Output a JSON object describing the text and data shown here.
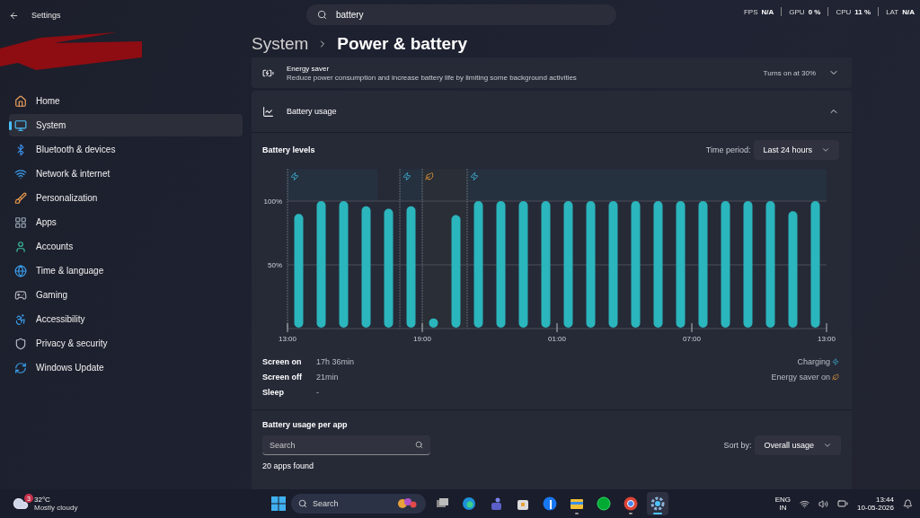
{
  "window": {
    "title": "Settings"
  },
  "search": {
    "value": "battery"
  },
  "overlay_stats": [
    {
      "label": "FPS",
      "value": "N/A"
    },
    {
      "label": "GPU",
      "value": "0 %"
    },
    {
      "label": "CPU",
      "value": "11 %"
    },
    {
      "label": "LAT",
      "value": "N/A"
    }
  ],
  "sidebar": {
    "items": [
      {
        "label": "Home",
        "selected": false
      },
      {
        "label": "System",
        "selected": true
      },
      {
        "label": "Bluetooth & devices",
        "selected": false
      },
      {
        "label": "Network & internet",
        "selected": false
      },
      {
        "label": "Personalization",
        "selected": false
      },
      {
        "label": "Apps",
        "selected": false
      },
      {
        "label": "Accounts",
        "selected": false
      },
      {
        "label": "Time & language",
        "selected": false
      },
      {
        "label": "Gaming",
        "selected": false
      },
      {
        "label": "Accessibility",
        "selected": false
      },
      {
        "label": "Privacy & security",
        "selected": false
      },
      {
        "label": "Windows Update",
        "selected": false
      }
    ]
  },
  "breadcrumb": {
    "parent": "System",
    "current": "Power & battery"
  },
  "energy_saver": {
    "title": "Energy saver",
    "description": "Reduce power consumption and increase battery life by limiting some background activities",
    "status": "Turns on at 30%",
    "expanded": false
  },
  "battery_usage": {
    "title": "Battery usage",
    "expanded": true,
    "levels_title": "Battery levels",
    "time_period_label": "Time period:",
    "time_period": "Last 24 hours",
    "chart_data": {
      "type": "bar",
      "categories": [
        "13:00",
        null,
        null,
        null,
        null,
        null,
        "19:00",
        null,
        null,
        null,
        null,
        null,
        "01:00",
        null,
        null,
        null,
        null,
        null,
        "07:00",
        null,
        null,
        null,
        null,
        null
      ],
      "series": [
        {
          "color": "#2bb5bd",
          "values": [
            90,
            100,
            100,
            96,
            94,
            96,
            8,
            89,
            100,
            100,
            100,
            100,
            100,
            100,
            100,
            100,
            100,
            100,
            100,
            100,
            100,
            100,
            92,
            100
          ]
        }
      ],
      "ylim": [
        0,
        125
      ],
      "grid": true,
      "yticks": [
        {
          "value": 50,
          "label": "50%"
        },
        {
          "value": 100,
          "label": "100%"
        }
      ]
    },
    "axis_end_label": "13:00",
    "bands": [
      {
        "kind": "charging"
      },
      {
        "kind": "charging"
      },
      {
        "kind": "energy_saver"
      },
      {
        "kind": "charging"
      }
    ],
    "stats": [
      {
        "label": "Screen on",
        "value": "17h 36min"
      },
      {
        "label": "Screen off",
        "value": "21min"
      },
      {
        "label": "Sleep",
        "value": "-"
      }
    ],
    "legend": [
      {
        "label": "Charging",
        "kind": "charging"
      },
      {
        "label": "Energy saver on",
        "kind": "energy_saver"
      }
    ]
  },
  "per_app": {
    "title": "Battery usage per app",
    "search_placeholder": "Search",
    "sort_label": "Sort by:",
    "sort_value": "Overall usage",
    "count": "20 apps found"
  },
  "taskbar": {
    "weather": {
      "badge": "3",
      "temp": "32°C",
      "condition": "Mostly cloudy"
    },
    "search_placeholder": "Search",
    "apps": [
      {
        "running": false,
        "selected": false
      },
      {
        "running": false,
        "selected": false
      },
      {
        "running": false,
        "selected": false
      },
      {
        "running": false,
        "selected": false
      },
      {
        "running": false,
        "selected": false
      },
      {
        "running": true,
        "selected": false
      },
      {
        "running": false,
        "selected": false
      },
      {
        "running": true,
        "selected": false
      },
      {
        "running": true,
        "selected": true
      }
    ],
    "language": "ENG",
    "region": "IN",
    "time": "13:44",
    "date": "10-05-2026"
  }
}
